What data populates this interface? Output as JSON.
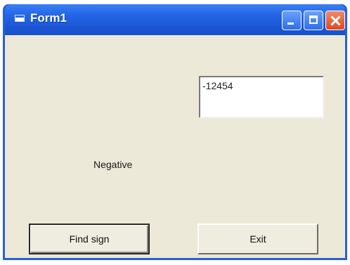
{
  "window": {
    "title": "Form1"
  },
  "form": {
    "input_value": "-12454",
    "result_label": "Negative",
    "find_sign_label": "Find sign",
    "exit_label": "Exit"
  },
  "colors": {
    "titlebar": "#1b55d4",
    "client_bg": "#ece9d8",
    "close_button": "#d94a22"
  },
  "icons": {
    "system": "app-icon",
    "minimize": "minimize-icon",
    "maximize": "maximize-icon",
    "close": "close-icon"
  }
}
